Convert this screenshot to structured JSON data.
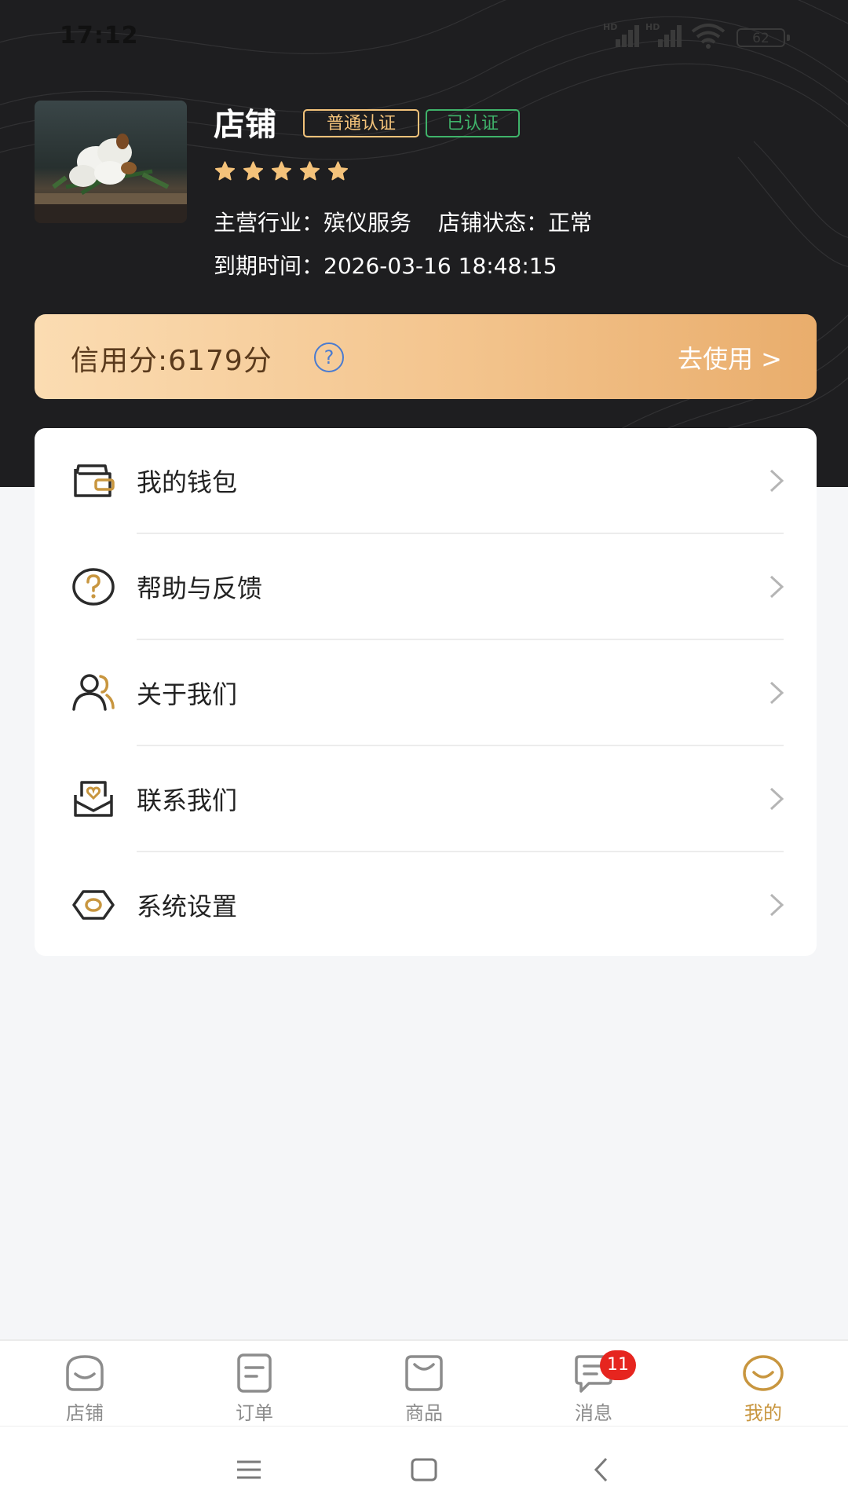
{
  "status_bar": {
    "time": "17:12",
    "battery": "62",
    "signal_label": "HD"
  },
  "shop": {
    "title": "店铺",
    "badge_normal": "普通认证",
    "badge_verified": "已认证",
    "rating_stars": 5,
    "industry_label": "主营行业：",
    "industry_value": "殡仪服务",
    "status_label": "店铺状态：",
    "status_value": "正常",
    "expire_label": "到期时间：",
    "expire_value": "2026-03-16 18:48:15"
  },
  "credit": {
    "text": "信用分:6179分",
    "help_glyph": "?",
    "use_label": "去使用 >"
  },
  "menu": {
    "items": [
      {
        "label": "我的钱包",
        "icon": "wallet-icon"
      },
      {
        "label": "帮助与反馈",
        "icon": "help-icon"
      },
      {
        "label": "关于我们",
        "icon": "users-icon"
      },
      {
        "label": "联系我们",
        "icon": "contact-mail-icon"
      },
      {
        "label": "系统设置",
        "icon": "settings-icon"
      }
    ]
  },
  "bottom_nav": {
    "items": [
      {
        "label": "店铺",
        "icon": "shop-icon"
      },
      {
        "label": "订单",
        "icon": "order-icon"
      },
      {
        "label": "商品",
        "icon": "goods-icon"
      },
      {
        "label": "消息",
        "icon": "message-icon"
      },
      {
        "label": "我的",
        "icon": "profile-icon"
      }
    ],
    "active_index": 4,
    "message_badge": "11"
  },
  "colors": {
    "accent": "#c8963f",
    "header_bg": "#1e1e20",
    "credit_start": "#fbdcb2",
    "credit_end": "#e9ad6c",
    "verified_green": "#3fb36a",
    "badge_red": "#e6251f"
  }
}
